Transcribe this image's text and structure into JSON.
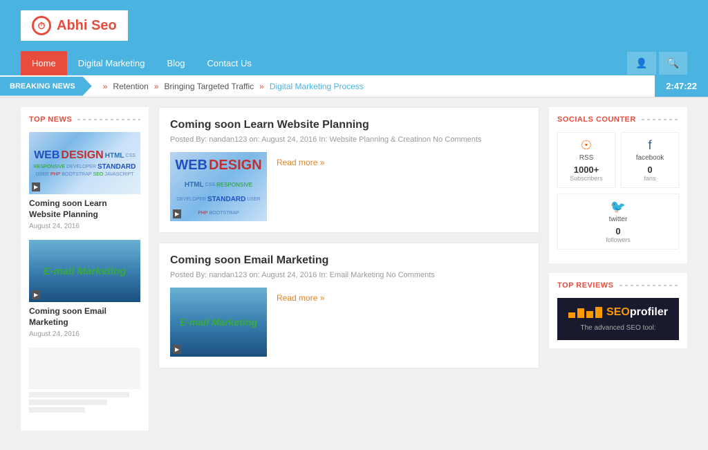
{
  "header": {
    "logo_text": "Abhi",
    "logo_text2": " Seo"
  },
  "nav": {
    "items": [
      {
        "label": "Home",
        "active": true
      },
      {
        "label": "Digital Marketing",
        "active": false
      },
      {
        "label": "Blog",
        "active": false
      },
      {
        "label": "Contact Us",
        "active": false
      }
    ]
  },
  "breaking_news": {
    "label": "BREAKING NEWS",
    "items": [
      "Retention",
      "Bringing Targeted Traffic",
      "Digital Marketing Process"
    ],
    "time": "2:47:22"
  },
  "sidebar_left": {
    "section_title": "TOP NEWS",
    "news_items": [
      {
        "title": "Coming soon Learn Website Planning",
        "date": "August 24, 2016"
      },
      {
        "title": "Coming soon Email Marketing",
        "date": "August 24, 2016"
      }
    ]
  },
  "articles": [
    {
      "title": "Coming soon Learn Website Planning",
      "meta": "Posted By: nandan123   on: August 24, 2016   In: Website Planning & Creatinon   No Comments",
      "read_more": "Read more »"
    },
    {
      "title": "Coming soon Email Marketing",
      "meta": "Posted By: nandan123   on: August 24, 2016   In: Email Marketing   No Comments",
      "read_more": "Read more »"
    }
  ],
  "sidebar_right": {
    "socials_title": "SOCIALS COUNTER",
    "rss": {
      "name": "RSS",
      "count": "1000+",
      "label": "Subscribers"
    },
    "facebook": {
      "name": "facebook",
      "count": "0",
      "label": "fans"
    },
    "twitter": {
      "name": "twitter",
      "count": "0",
      "label": "followers"
    },
    "reviews_title": "TOP REVIEWS",
    "seo_tagline": "The advanced SEO tool:"
  }
}
